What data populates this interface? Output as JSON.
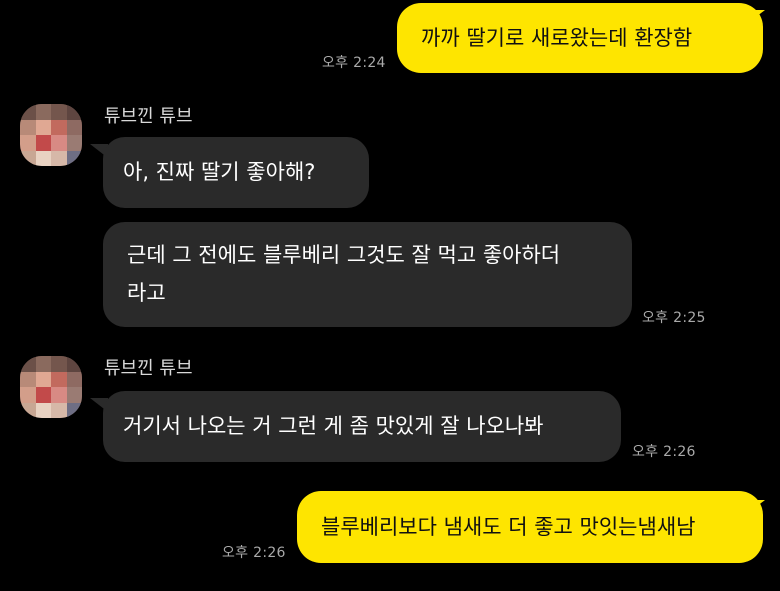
{
  "chat": {
    "sender_name": "튜브낀 튜브",
    "messages": [
      {
        "from": "me",
        "text": "까까 딸기로 새로왔는데 환장함",
        "time": "오후 2:24"
      },
      {
        "from": "other",
        "text": "아, 진짜 딸기 좋아해?"
      },
      {
        "from": "other",
        "line1": "근데 그 전에도 블루베리 그것도 잘 먹고 좋아하더",
        "line2": "라고",
        "time": "오후 2:25"
      },
      {
        "from": "other",
        "text": "거기서 나오는 거 그런 게 좀 맛있게 잘 나오나봐",
        "time": "오후 2:26"
      },
      {
        "from": "me",
        "text": "블루베리보다 냄새도 더 좋고 맛잇는냄새남",
        "time": "오후 2:26"
      }
    ]
  },
  "colors": {
    "background": "#000000",
    "my_bubble": "#fee500",
    "other_bubble": "#2a2a2a",
    "timestamp": "#a9a9a9"
  },
  "icons": {
    "avatar": "pixelated-profile-avatar"
  }
}
